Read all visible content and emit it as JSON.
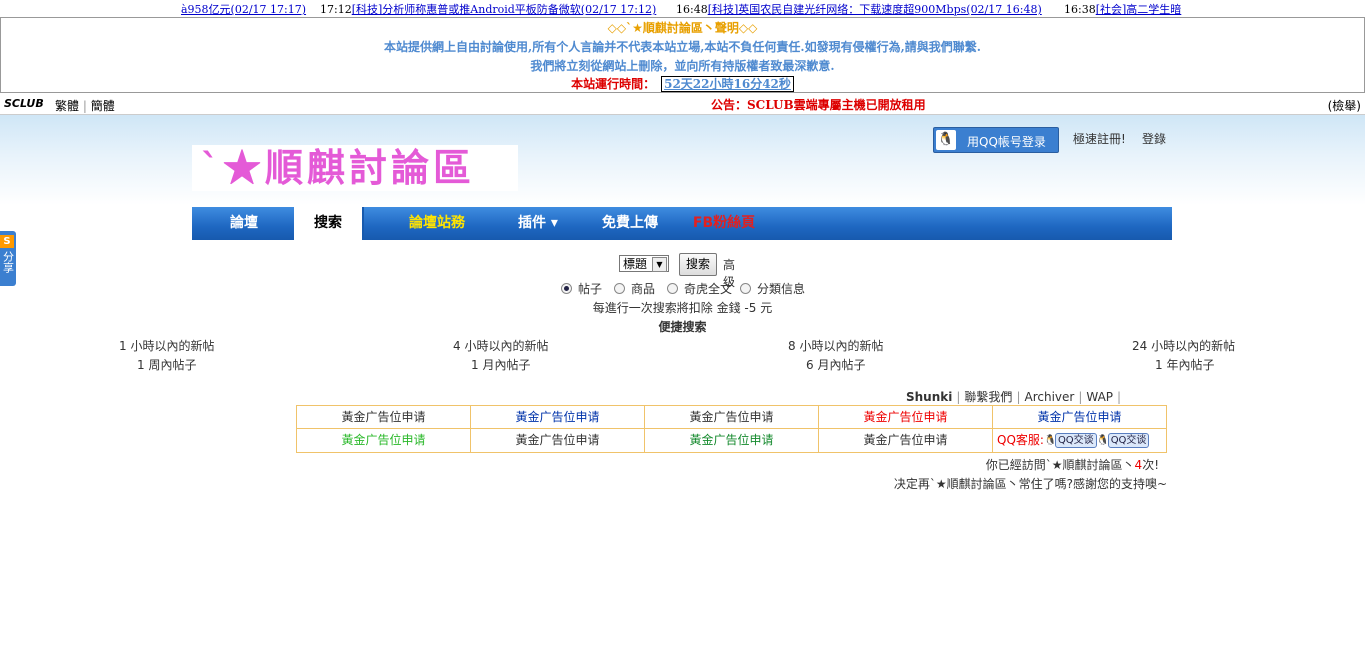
{
  "ticker": {
    "items": [
      {
        "time": "",
        "text": "à958亿元(02/17 17:17)"
      },
      {
        "time": "17:12",
        "text": "[科技]分析师称惠普或推Android平板防备微软(02/17 17:12)"
      },
      {
        "time": "16:48",
        "text": "[科技]英国农民自建光纤网络：下载速度超900Mbps(02/17 16:48)"
      },
      {
        "time": "16:38",
        "text": "[社会]高二学生暗"
      }
    ]
  },
  "announce": {
    "title": "◇◇`★順麒討論區丶聲明◇◇",
    "line1": "本站提供網上自由討論使用,所有个人言論并不代表本站立場,本站不負任何責任.如發現有侵權行為,請與我們聯繫.",
    "line2": "我們將立刻從網站上刪除，並向所有持版權者致最深歉意.",
    "uptime_label": "本站運行時間：",
    "uptime_value": "52天22小時16分42秒"
  },
  "topbar": {
    "logo": "SCLUB",
    "lang_traditional": "繁體",
    "lang_simplified": "簡體",
    "notice": "公告：SCLUB雲端專屬主機已開放租用",
    "check": "(檢舉)"
  },
  "header": {
    "site_logo": "`★順麒討論區",
    "qq_login": "用QQ帳号登录",
    "qq_icon": "qq-penguin-icon",
    "register": "極速註冊!",
    "login": "登錄"
  },
  "share": {
    "badge": "S",
    "label": "分享"
  },
  "nav": {
    "tabs": [
      {
        "label": "論壇",
        "style": "normal"
      },
      {
        "label": "搜索",
        "style": "active"
      },
      {
        "label": "論壇站務",
        "style": "yellow"
      },
      {
        "label": "插件 ▾",
        "style": "normal"
      },
      {
        "label": "免費上傳",
        "style": "normal"
      },
      {
        "label": "FB粉絲頁",
        "style": "red"
      }
    ]
  },
  "search": {
    "select_value": "標題",
    "button": "搜索",
    "advanced": "高级",
    "types": [
      {
        "label": "帖子",
        "checked": true
      },
      {
        "label": "商品",
        "checked": false
      },
      {
        "label": "奇虎全文",
        "checked": false
      },
      {
        "label": "分類信息",
        "checked": false
      }
    ],
    "cost_note": "每進行一次搜索將扣除 金錢 -5 元",
    "quick_title": "便捷搜索",
    "quick_links": [
      "1 小時以內的新帖",
      "4 小時以內的新帖",
      "8 小時以內的新帖",
      "24 小時以內的新帖",
      "1 周內帖子",
      "1 月內帖子",
      "6 月內帖子",
      "1 年內帖子"
    ]
  },
  "footer": {
    "links": [
      "Shunki",
      "聯繫我們",
      "Archiver",
      "WAP"
    ],
    "ads_row1": [
      "黃金广告位申请",
      "黃金广告位申请",
      "黃金广告位申请",
      "黃金广告位申请",
      "黃金广告位申请"
    ],
    "ads_row2": [
      "黃金广告位申请",
      "黃金广告位申请",
      "黃金广告位申请",
      "黃金广告位申请"
    ],
    "qq_service_label": "QQ客服:",
    "qq_chat_button": "QQ交谈",
    "visit_prefix": "你已經訪問`★順麒討論區丶",
    "visit_count": "4",
    "visit_suffix": "次!",
    "support_text": "决定再`★順麒討論區丶常住了嗎?感謝您的支持噢~"
  },
  "colors": {
    "nav_blue": "#1e67c1",
    "announce_blue": "#4f8ad0",
    "alert_red": "#dd0000",
    "ad_border": "#f0c36a"
  }
}
